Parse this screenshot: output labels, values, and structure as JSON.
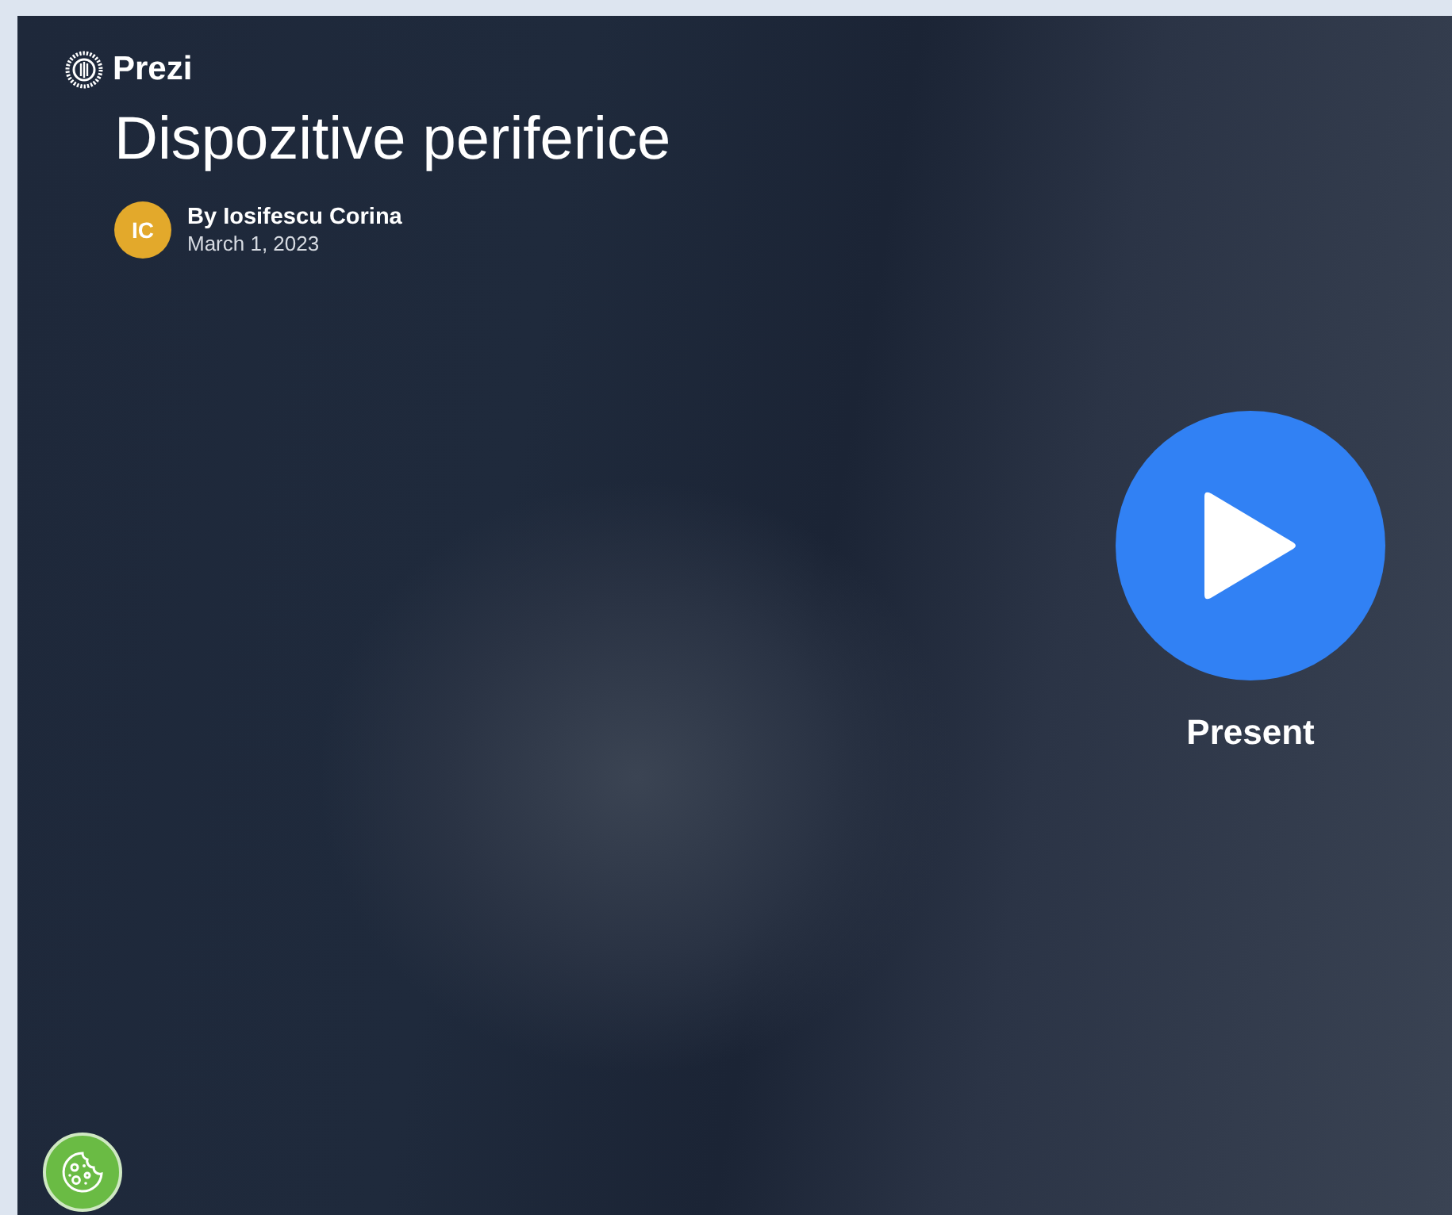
{
  "brand": {
    "name": "Prezi"
  },
  "presentation": {
    "title": "Dispozitive periferice",
    "author_initials": "IC",
    "author": "By Iosifescu Corina",
    "date": "March 1, 2023"
  },
  "present_button": {
    "label": "Present"
  }
}
